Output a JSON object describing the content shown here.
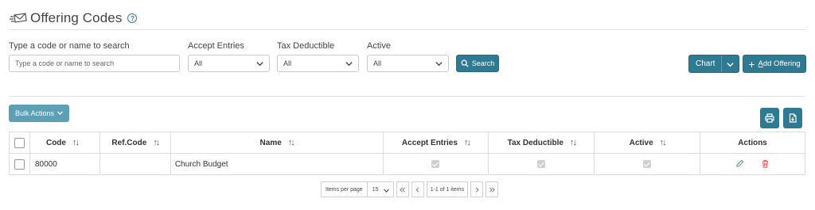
{
  "header": {
    "title": "Offering Codes",
    "help": "?"
  },
  "filters": {
    "search_label": "Type a code or name to search",
    "search_placeholder": "Type a code or name to search",
    "accept_label": "Accept Entries",
    "accept_value": "All",
    "tax_label": "Tax Deductible",
    "tax_value": "All",
    "active_label": "Active",
    "active_value": "All",
    "search_button": "Search"
  },
  "toolbar": {
    "chart_label": "Chart",
    "add_plus": "+",
    "add_first_letter": "A",
    "add_rest": "dd Offering",
    "bulk_label": "Bulk Actions"
  },
  "table": {
    "columns": [
      "Code",
      "Ref.Code",
      "Name",
      "Accept Entries",
      "Tax Deductible",
      "Active",
      "Actions"
    ],
    "sort_glyph": "↑↓",
    "rows": [
      {
        "code": "80000",
        "ref_code": "",
        "name": "Church Budget",
        "accept_entries": true,
        "tax_deductible": true,
        "active": true
      }
    ]
  },
  "pager": {
    "items_per_page_label": "Items per page",
    "page_size": "15",
    "first": "|<",
    "prev": "<",
    "range": "1-1 of 1 items",
    "next": ">",
    "last": ">|"
  },
  "colors": {
    "primary": "#2e7a93",
    "bulk": "#5d9fb5",
    "delete": "#e05555",
    "edit": "#4a8fa8"
  }
}
